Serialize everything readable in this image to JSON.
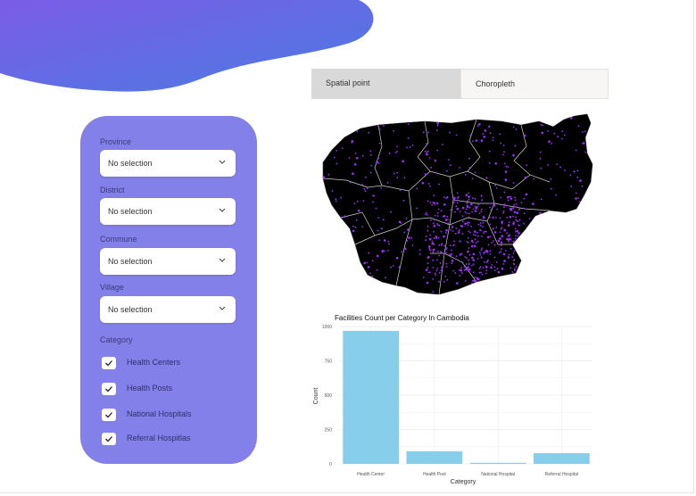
{
  "tabs": [
    {
      "label": "Spatial point",
      "active": true
    },
    {
      "label": "Choropleth",
      "active": false
    }
  ],
  "filters": {
    "province": {
      "label": "Province",
      "value": "No selection"
    },
    "district": {
      "label": "District",
      "value": "No selection"
    },
    "commune": {
      "label": "Commune",
      "value": "No selection"
    },
    "village": {
      "label": "Village",
      "value": "No selection"
    },
    "category": {
      "label": "Category",
      "options": [
        {
          "label": "Health Centers",
          "checked": true
        },
        {
          "label": "Health Posts",
          "checked": true
        },
        {
          "label": "National Hospitals",
          "checked": true
        },
        {
          "label": "Referral Hospitlas",
          "checked": true
        }
      ]
    }
  },
  "colors": {
    "header_gradient_start": "#7b5ce6",
    "header_gradient_end": "#4b7be3",
    "panel": "#8480e9",
    "bar": "#87ceeb",
    "map_land": "#000000",
    "map_points": "#9b30ff"
  },
  "icons": {
    "dropdown": "chevron-down-icon",
    "checkbox": "checkmark-icon"
  },
  "chart_data": {
    "type": "bar",
    "title": "Facilities Count per Category In Cambodia",
    "xlabel": "Category",
    "ylabel": "Count",
    "categories": [
      "Health Center",
      "Health Post",
      "National Hospital",
      "Referral Hospital"
    ],
    "values": [
      968,
      92,
      8,
      78
    ],
    "ylim": [
      0,
      1000
    ],
    "yticks": [
      0,
      250,
      500,
      750,
      1000
    ],
    "grid": true,
    "legend": "none"
  }
}
